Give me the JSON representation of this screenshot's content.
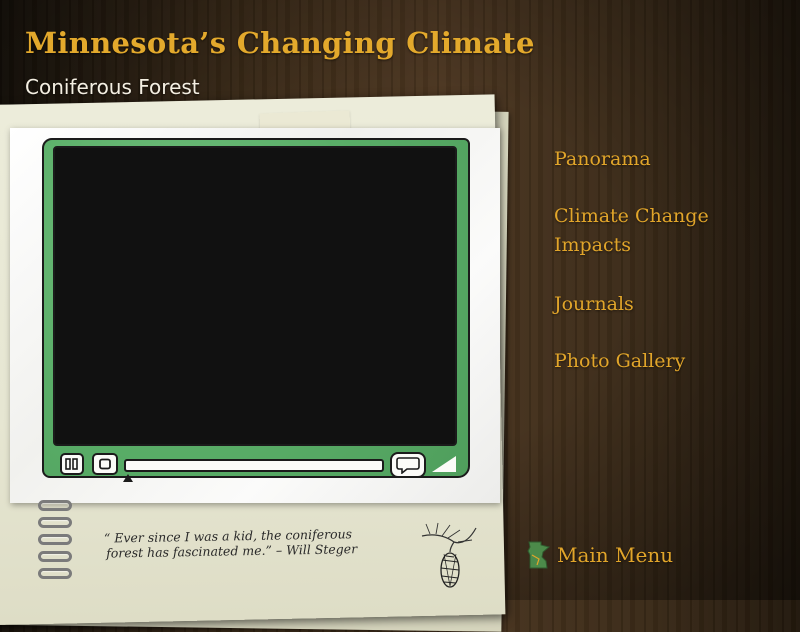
{
  "header": {
    "title": "Minnesota’s Changing Climate",
    "subtitle": "Coniferous Forest"
  },
  "video_player": {
    "progress": 0,
    "controls": [
      "play-pause-icon",
      "stop-icon",
      "caption-icon",
      "volume-icon"
    ]
  },
  "quote": {
    "line1": "“ Ever since I was a kid, the coniferous",
    "line2": "forest has fascinated me.” – Will Steger"
  },
  "nav": {
    "items": [
      {
        "label": "Panorama"
      },
      {
        "label": "Climate Change"
      },
      {
        "label": "Impacts"
      },
      {
        "label": "Journals"
      },
      {
        "label": "Photo Gallery"
      }
    ]
  },
  "footer": {
    "main_menu_label": "Main Menu",
    "main_menu_icon": "minnesota-map-icon"
  },
  "colors": {
    "accent": "#e1a52a",
    "frame_green": "#5aae68",
    "screen": "#111111"
  }
}
